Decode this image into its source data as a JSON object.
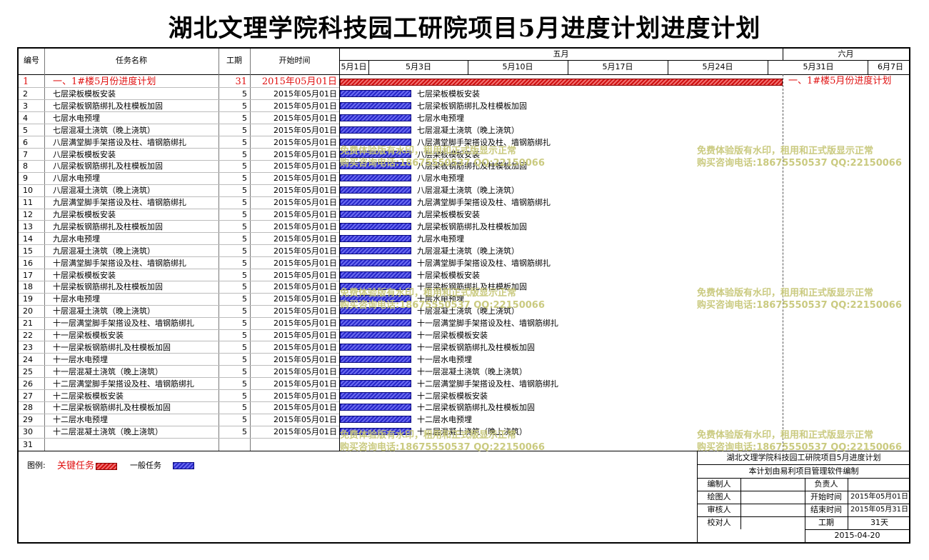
{
  "title": "湖北文理学院科技园工研院项目5月进度计划进度计划",
  "headers": {
    "id": "编号",
    "name": "任务名称",
    "duration": "工期",
    "start": "开始时间"
  },
  "timeline": {
    "month_may": "五月",
    "month_june": "六月",
    "ticks": [
      "5月1日",
      "5月3日",
      "5月10日",
      "5月17日",
      "5月24日",
      "5月31日",
      "6月7日"
    ]
  },
  "summary_task": {
    "id": "1",
    "name": "一、1#楼5月份进度计划",
    "duration": "31",
    "start": "2015年05月01日",
    "bar_label": "一、1#楼5月份进度计划"
  },
  "tasks": [
    {
      "id": "2",
      "name": "七层梁板模板安装",
      "duration": "5",
      "start": "2015年05月01日"
    },
    {
      "id": "3",
      "name": "七层梁板钢筋绑扎及柱模板加固",
      "duration": "5",
      "start": "2015年05月01日"
    },
    {
      "id": "4",
      "name": "七层水电预埋",
      "duration": "5",
      "start": "2015年05月01日"
    },
    {
      "id": "5",
      "name": "七层混凝土浇筑（晚上浇筑）",
      "duration": "5",
      "start": "2015年05月01日"
    },
    {
      "id": "6",
      "name": "八层满堂脚手架搭设及柱、墙钢筋绑扎",
      "duration": "5",
      "start": "2015年05月01日"
    },
    {
      "id": "7",
      "name": "八层梁板模板安装",
      "duration": "5",
      "start": "2015年05月01日"
    },
    {
      "id": "8",
      "name": "八层梁板钢筋绑扎及柱模板加固",
      "duration": "5",
      "start": "2015年05月01日"
    },
    {
      "id": "9",
      "name": "八层水电预埋",
      "duration": "5",
      "start": "2015年05月01日"
    },
    {
      "id": "10",
      "name": "八层混凝土浇筑（晚上浇筑）",
      "duration": "5",
      "start": "2015年05月01日"
    },
    {
      "id": "11",
      "name": "九层满堂脚手架搭设及柱、墙钢筋绑扎",
      "duration": "5",
      "start": "2015年05月01日"
    },
    {
      "id": "12",
      "name": "九层梁板模板安装",
      "duration": "5",
      "start": "2015年05月01日"
    },
    {
      "id": "13",
      "name": "九层梁板钢筋绑扎及柱模板加固",
      "duration": "5",
      "start": "2015年05月01日"
    },
    {
      "id": "14",
      "name": "九层水电预埋",
      "duration": "5",
      "start": "2015年05月01日"
    },
    {
      "id": "15",
      "name": "九层混凝土浇筑（晚上浇筑）",
      "duration": "5",
      "start": "2015年05月01日"
    },
    {
      "id": "16",
      "name": "十层满堂脚手架搭设及柱、墙钢筋绑扎",
      "duration": "5",
      "start": "2015年05月01日"
    },
    {
      "id": "17",
      "name": "十层梁板模板安装",
      "duration": "5",
      "start": "2015年05月01日"
    },
    {
      "id": "18",
      "name": "十层梁板钢筋绑扎及柱模板加固",
      "duration": "5",
      "start": "2015年05月01日"
    },
    {
      "id": "19",
      "name": "十层水电预埋",
      "duration": "5",
      "start": "2015年05月01日"
    },
    {
      "id": "20",
      "name": "十层混凝土浇筑（晚上浇筑）",
      "duration": "5",
      "start": "2015年05月01日"
    },
    {
      "id": "21",
      "name": "十一层满堂脚手架搭设及柱、墙钢筋绑扎",
      "duration": "5",
      "start": "2015年05月01日"
    },
    {
      "id": "22",
      "name": "十一层梁板模板安装",
      "duration": "5",
      "start": "2015年05月01日"
    },
    {
      "id": "23",
      "name": "十一层梁板钢筋绑扎及柱模板加固",
      "duration": "5",
      "start": "2015年05月01日"
    },
    {
      "id": "24",
      "name": "十一层水电预埋",
      "duration": "5",
      "start": "2015年05月01日"
    },
    {
      "id": "25",
      "name": "十一层混凝土浇筑（晚上浇筑）",
      "duration": "5",
      "start": "2015年05月01日"
    },
    {
      "id": "26",
      "name": "十二层满堂脚手架搭设及柱、墙钢筋绑扎",
      "duration": "5",
      "start": "2015年05月01日"
    },
    {
      "id": "27",
      "name": "十二层梁板模板安装",
      "duration": "5",
      "start": "2015年05月01日"
    },
    {
      "id": "28",
      "name": "十二层梁板钢筋绑扎及柱模板加固",
      "duration": "5",
      "start": "2015年05月01日"
    },
    {
      "id": "29",
      "name": "十二层水电预埋",
      "duration": "5",
      "start": "2015年05月01日"
    },
    {
      "id": "30",
      "name": "十二层混凝土浇筑（晚上浇筑）",
      "duration": "5",
      "start": "2015年05月01日"
    }
  ],
  "empty_row_id": "31",
  "legend": {
    "label": "图例:",
    "critical": "关键任务",
    "normal": "一般任务"
  },
  "watermark": {
    "line1": "免费体验版有水印，租用和正式版显示正常",
    "line2": "购买咨询电话:18675550537 QQ:22150066"
  },
  "title_block": {
    "project": "湖北文理学院科技园工研院项目5月进度计划",
    "note": "本计划由易利项目管理软件编制",
    "editor_label": "编制人",
    "owner_label": "负责人",
    "drawer_label": "绘图人",
    "start_label": "开始时间",
    "start_value": "2015年05月01日",
    "reviewer_label": "审核人",
    "end_label": "结束时间",
    "end_value": "2015年05月31日",
    "checker_label": "校对人",
    "duration_label": "工期",
    "duration_value": "31天",
    "date": "2015-04-20"
  },
  "colors": {
    "critical": "#e01010",
    "normal_bar": "#3a3ad8",
    "watermark": "#c8c87a"
  }
}
